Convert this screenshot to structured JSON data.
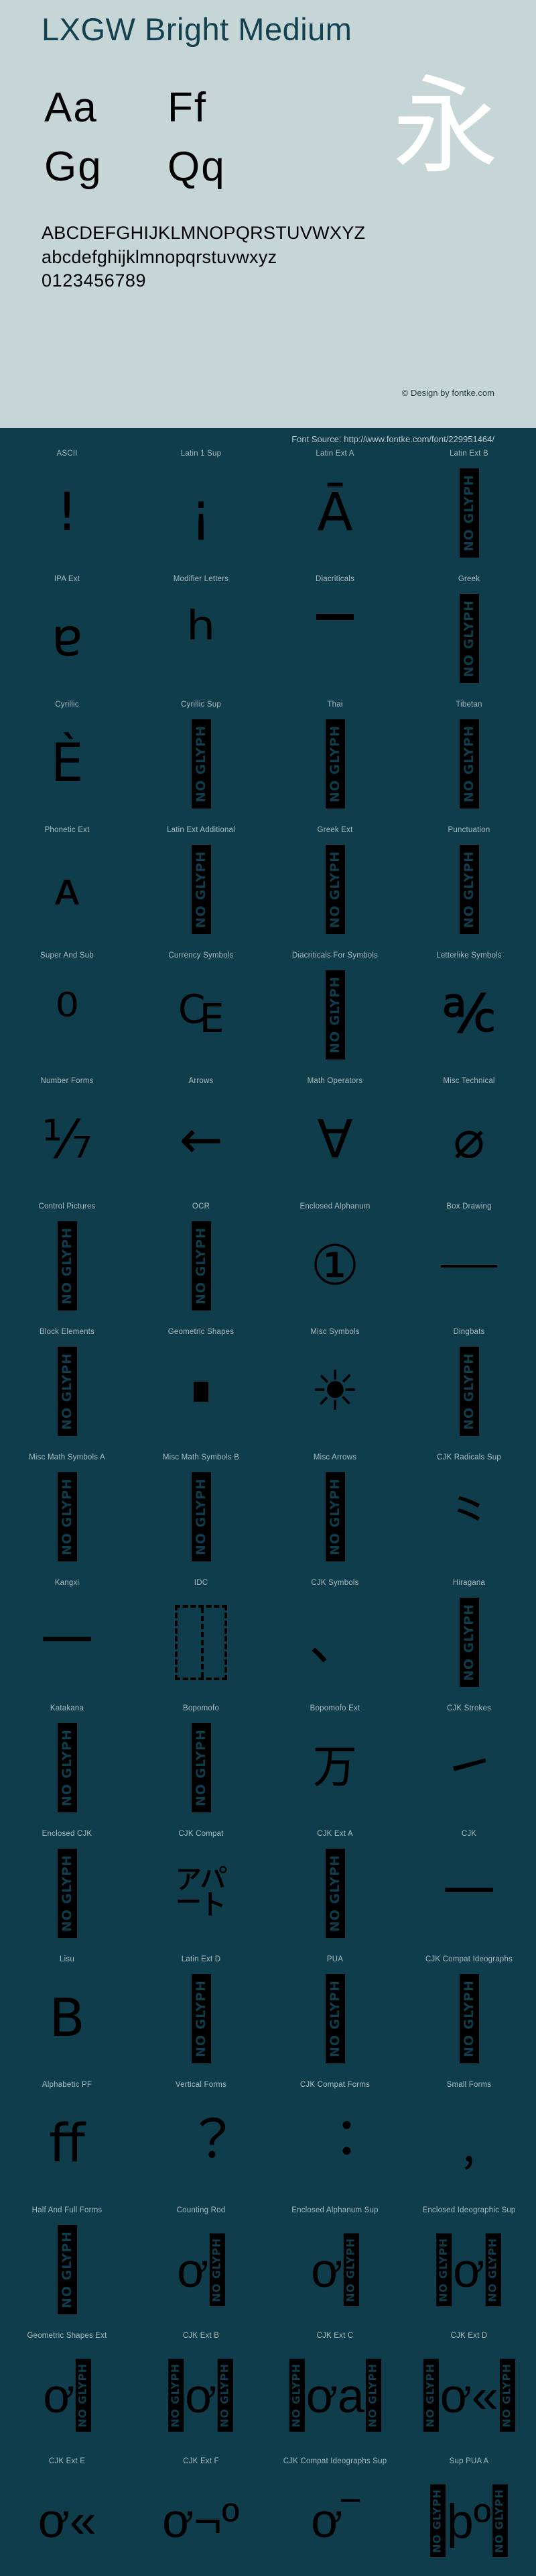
{
  "header": {
    "title": "LXGW Bright Medium",
    "samples": [
      {
        "name": "sample-aa",
        "text": "Aa"
      },
      {
        "name": "sample-ff",
        "text": "Ff"
      },
      {
        "name": "sample-gg",
        "text": "Gg"
      },
      {
        "name": "sample-qq",
        "text": "Qq"
      }
    ],
    "cjk_sample": "永",
    "uppercase": "ABCDEFGHIJKLMNOPQRSTUVWXYZ",
    "lowercase": "abcdefghijklmnopqrstuvwxyz",
    "digits": "0123456789",
    "copyright": "© Design by fontke.com",
    "bg_color": "#c6d6d6",
    "title_color": "#14414f"
  },
  "source_bar": {
    "text": "Font Source: http://www.fontke.com/font/229951464/",
    "bg_color": "#0f3d4b",
    "text_color": "#b6c9cd"
  },
  "grid": {
    "columns": 4,
    "label_color": "#a9bdc1",
    "glyph_color": "#000000",
    "no_glyph_label": "NO GLYPH",
    "cells": [
      {
        "label": "ASCII",
        "glyph": "!",
        "size": 78,
        "type": "glyph"
      },
      {
        "label": "Latin 1 Sup",
        "glyph": "¡",
        "size": 78,
        "type": "glyph"
      },
      {
        "label": "Latin Ext A",
        "glyph": "Ā",
        "size": 78,
        "type": "glyph"
      },
      {
        "label": "Latin Ext B",
        "glyph": "",
        "size": 0,
        "type": "noglyph"
      },
      {
        "label": "IPA Ext",
        "glyph": "ɐ",
        "size": 78,
        "type": "glyph"
      },
      {
        "label": "Modifier Letters",
        "glyph": "ʰ",
        "size": 108,
        "type": "glyph"
      },
      {
        "label": "Diacriticals",
        "glyph": "̄",
        "size": 78,
        "type": "macron"
      },
      {
        "label": "Greek",
        "glyph": "",
        "size": 0,
        "type": "noglyph"
      },
      {
        "label": "Cyrillic",
        "glyph": "Ѐ",
        "size": 78,
        "type": "glyph"
      },
      {
        "label": "Cyrillic Sup",
        "glyph": "",
        "size": 0,
        "type": "noglyph"
      },
      {
        "label": "Thai",
        "glyph": "",
        "size": 0,
        "type": "noglyph"
      },
      {
        "label": "Tibetan",
        "glyph": "",
        "size": 0,
        "type": "noglyph"
      },
      {
        "label": "Phonetic Ext",
        "glyph": "ᴀ",
        "size": 68,
        "type": "glyph"
      },
      {
        "label": "Latin Ext Additional",
        "glyph": "",
        "size": 0,
        "type": "noglyph"
      },
      {
        "label": "Greek Ext",
        "glyph": "",
        "size": 0,
        "type": "noglyph"
      },
      {
        "label": "Punctuation",
        "glyph": "",
        "size": 0,
        "type": "noglyph"
      },
      {
        "label": "Super And Sub",
        "glyph": "⁰",
        "size": 88,
        "type": "glyph"
      },
      {
        "label": "Currency Symbols",
        "glyph": "₠",
        "size": 78,
        "type": "glyph"
      },
      {
        "label": "Diacriticals For Symbols",
        "glyph": "",
        "size": 0,
        "type": "noglyph"
      },
      {
        "label": "Letterlike Symbols",
        "glyph": "℀",
        "size": 78,
        "type": "glyph"
      },
      {
        "label": "Number Forms",
        "glyph": "⅐",
        "size": 78,
        "type": "glyph"
      },
      {
        "label": "Arrows",
        "glyph": "←",
        "size": 78,
        "type": "glyph"
      },
      {
        "label": "Math Operators",
        "glyph": "∀",
        "size": 78,
        "type": "glyph"
      },
      {
        "label": "Misc Technical",
        "glyph": "⌀",
        "size": 78,
        "type": "glyph"
      },
      {
        "label": "Control Pictures",
        "glyph": "",
        "size": 0,
        "type": "noglyph"
      },
      {
        "label": "OCR",
        "glyph": "",
        "size": 0,
        "type": "noglyph"
      },
      {
        "label": "Enclosed Alphanum",
        "glyph": "①",
        "size": 82,
        "type": "glyph"
      },
      {
        "label": "Box Drawing",
        "glyph": "─",
        "size": 78,
        "type": "boxline"
      },
      {
        "label": "Block Elements",
        "glyph": "",
        "size": 0,
        "type": "noglyph"
      },
      {
        "label": "Geometric Shapes",
        "glyph": "▪",
        "size": 78,
        "type": "square"
      },
      {
        "label": "Misc Symbols",
        "glyph": "☀",
        "size": 82,
        "type": "glyph"
      },
      {
        "label": "Dingbats",
        "glyph": "",
        "size": 0,
        "type": "noglyph"
      },
      {
        "label": "Misc Math Symbols A",
        "glyph": "",
        "size": 0,
        "type": "noglyph"
      },
      {
        "label": "Misc Math Symbols B",
        "glyph": "",
        "size": 0,
        "type": "noglyph"
      },
      {
        "label": "Misc Arrows",
        "glyph": "",
        "size": 0,
        "type": "noglyph"
      },
      {
        "label": "CJK Radicals Sup",
        "glyph": "⺀",
        "size": 78,
        "type": "glyph"
      },
      {
        "label": "Kangxi",
        "glyph": "一",
        "size": 78,
        "type": "glyph"
      },
      {
        "label": "IDC",
        "glyph": "⿰",
        "size": 78,
        "type": "idc"
      },
      {
        "label": "CJK Symbols",
        "glyph": "、",
        "size": 78,
        "type": "glyph"
      },
      {
        "label": "Hiragana",
        "glyph": "",
        "size": 0,
        "type": "noglyph"
      },
      {
        "label": "Katakana",
        "glyph": "",
        "size": 0,
        "type": "noglyph"
      },
      {
        "label": "Bopomofo",
        "glyph": "",
        "size": 0,
        "type": "noglyph"
      },
      {
        "label": "Bopomofo Ext",
        "glyph": "ㄪ",
        "size": 72,
        "type": "glyph"
      },
      {
        "label": "CJK Strokes",
        "glyph": "㇀",
        "size": 78,
        "type": "glyph"
      },
      {
        "label": "Enclosed CJK",
        "glyph": "",
        "size": 0,
        "type": "noglyph"
      },
      {
        "label": "CJK Compat",
        "glyph": "㌀",
        "size": 78,
        "type": "glyph"
      },
      {
        "label": "CJK Ext A",
        "glyph": "",
        "size": 0,
        "type": "noglyph"
      },
      {
        "label": "CJK",
        "glyph": "一",
        "size": 78,
        "type": "glyph"
      },
      {
        "label": "Lisu",
        "glyph": "ꓐ",
        "size": 78,
        "type": "glyph"
      },
      {
        "label": "Latin Ext D",
        "glyph": "",
        "size": 0,
        "type": "noglyph"
      },
      {
        "label": "PUA",
        "glyph": "",
        "size": 0,
        "type": "noglyph"
      },
      {
        "label": "CJK Compat Ideographs",
        "glyph": "",
        "size": 0,
        "type": "noglyph"
      },
      {
        "label": "Alphabetic PF",
        "glyph": "ﬀ",
        "size": 78,
        "type": "glyph"
      },
      {
        "label": "Vertical Forms",
        "glyph": "︖",
        "size": 78,
        "type": "glyph"
      },
      {
        "label": "CJK Compat Forms",
        "glyph": "︓",
        "size": 78,
        "type": "glyph"
      },
      {
        "label": "Small Forms",
        "glyph": "﹐",
        "size": 78,
        "type": "glyph"
      },
      {
        "label": "Half And Full Forms",
        "glyph": "",
        "size": 0,
        "type": "noglyph"
      },
      {
        "label": "Counting Rod",
        "glyph": "ơ",
        "size": 78,
        "type": "cluster2"
      },
      {
        "label": "Enclosed Alphanum Sup",
        "glyph": "ơ",
        "size": 78,
        "type": "cluster2"
      },
      {
        "label": "Enclosed Ideographic Sup",
        "glyph": "ơ",
        "size": 78,
        "type": "cluster3"
      },
      {
        "label": "Geometric Shapes Ext",
        "glyph": "ơ",
        "size": 78,
        "type": "cluster2"
      },
      {
        "label": "CJK Ext B",
        "glyph": "ơ",
        "size": 78,
        "type": "cluster3"
      },
      {
        "label": "CJK Ext C",
        "glyph": "ơa",
        "size": 78,
        "type": "cluster3"
      },
      {
        "label": "CJK Ext D",
        "glyph": "ơ«",
        "size": 78,
        "type": "cluster3"
      },
      {
        "label": "CJK Ext E",
        "glyph": "ơ«",
        "size": 78,
        "type": "tail"
      },
      {
        "label": "CJK Ext F",
        "glyph": "ơ¬º",
        "size": 78,
        "type": "tail"
      },
      {
        "label": "CJK Compat Ideographs Sup",
        "glyph": "ơ‾",
        "size": 78,
        "type": "tail"
      },
      {
        "label": "Sup PUA A",
        "glyph": "þº",
        "size": 78,
        "type": "tailng"
      }
    ]
  }
}
